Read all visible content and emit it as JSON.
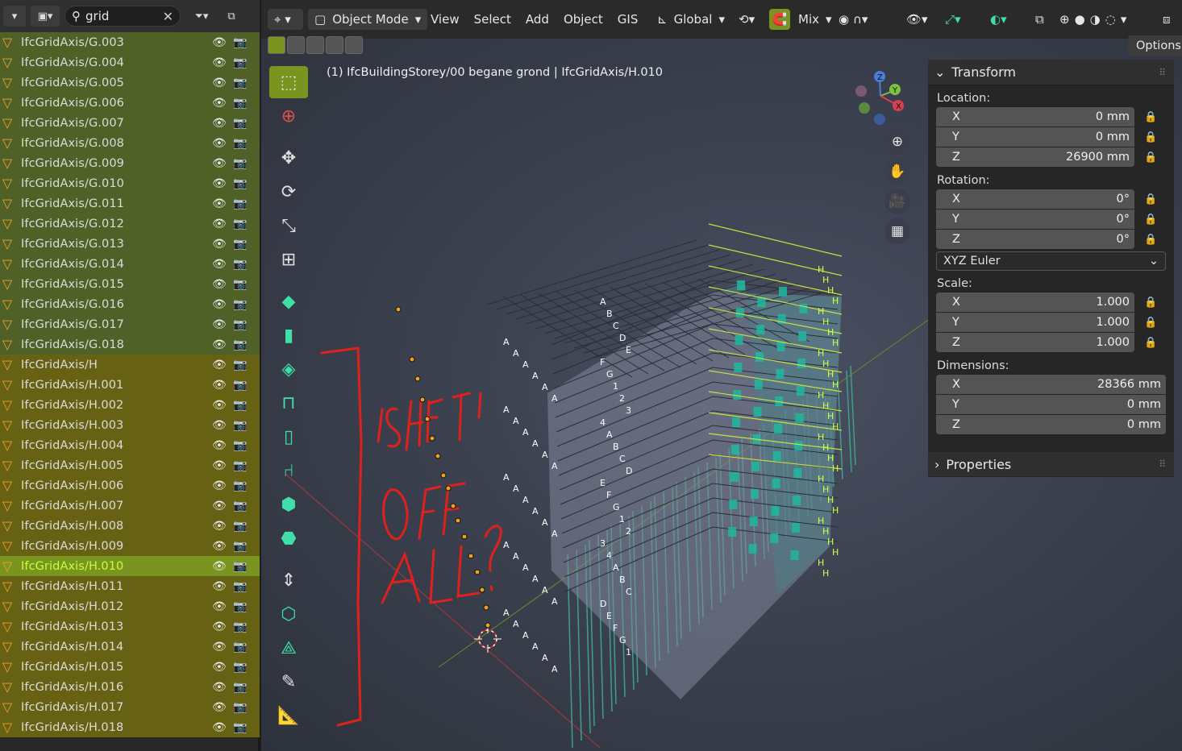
{
  "outliner": {
    "search_value": "grid",
    "items": [
      {
        "label": "IfcGridAxis/G.003",
        "group": "g"
      },
      {
        "label": "IfcGridAxis/G.004",
        "group": "g"
      },
      {
        "label": "IfcGridAxis/G.005",
        "group": "g"
      },
      {
        "label": "IfcGridAxis/G.006",
        "group": "g"
      },
      {
        "label": "IfcGridAxis/G.007",
        "group": "g"
      },
      {
        "label": "IfcGridAxis/G.008",
        "group": "g"
      },
      {
        "label": "IfcGridAxis/G.009",
        "group": "g"
      },
      {
        "label": "IfcGridAxis/G.010",
        "group": "g"
      },
      {
        "label": "IfcGridAxis/G.011",
        "group": "g"
      },
      {
        "label": "IfcGridAxis/G.012",
        "group": "g"
      },
      {
        "label": "IfcGridAxis/G.013",
        "group": "g"
      },
      {
        "label": "IfcGridAxis/G.014",
        "group": "g"
      },
      {
        "label": "IfcGridAxis/G.015",
        "group": "g"
      },
      {
        "label": "IfcGridAxis/G.016",
        "group": "g"
      },
      {
        "label": "IfcGridAxis/G.017",
        "group": "g"
      },
      {
        "label": "IfcGridAxis/G.018",
        "group": "g"
      },
      {
        "label": "IfcGridAxis/H",
        "group": "h"
      },
      {
        "label": "IfcGridAxis/H.001",
        "group": "h"
      },
      {
        "label": "IfcGridAxis/H.002",
        "group": "h"
      },
      {
        "label": "IfcGridAxis/H.003",
        "group": "h"
      },
      {
        "label": "IfcGridAxis/H.004",
        "group": "h"
      },
      {
        "label": "IfcGridAxis/H.005",
        "group": "h"
      },
      {
        "label": "IfcGridAxis/H.006",
        "group": "h"
      },
      {
        "label": "IfcGridAxis/H.007",
        "group": "h"
      },
      {
        "label": "IfcGridAxis/H.008",
        "group": "h"
      },
      {
        "label": "IfcGridAxis/H.009",
        "group": "h"
      },
      {
        "label": "IfcGridAxis/H.010",
        "group": "sel"
      },
      {
        "label": "IfcGridAxis/H.011",
        "group": "h"
      },
      {
        "label": "IfcGridAxis/H.012",
        "group": "h"
      },
      {
        "label": "IfcGridAxis/H.013",
        "group": "h"
      },
      {
        "label": "IfcGridAxis/H.014",
        "group": "h"
      },
      {
        "label": "IfcGridAxis/H.015",
        "group": "h"
      },
      {
        "label": "IfcGridAxis/H.016",
        "group": "h"
      },
      {
        "label": "IfcGridAxis/H.017",
        "group": "h"
      },
      {
        "label": "IfcGridAxis/H.018",
        "group": "h"
      }
    ]
  },
  "header": {
    "mode": "Object Mode",
    "menus": [
      "View",
      "Select",
      "Add",
      "Object",
      "GIS"
    ],
    "orientation": "Global",
    "snap_target": "Mix",
    "options": "Options"
  },
  "viewport": {
    "breadcrumb": "(1) IfcBuildingStorey/00 begane grond | IfcGridAxis/H.010",
    "annotation": "SHIFT OFF ALL?"
  },
  "transform": {
    "title": "Transform",
    "location_label": "Location:",
    "location": [
      {
        "axis": "X",
        "value": "0 mm"
      },
      {
        "axis": "Y",
        "value": "0 mm"
      },
      {
        "axis": "Z",
        "value": "26900 mm"
      }
    ],
    "rotation_label": "Rotation:",
    "rotation": [
      {
        "axis": "X",
        "value": "0°"
      },
      {
        "axis": "Y",
        "value": "0°"
      },
      {
        "axis": "Z",
        "value": "0°"
      }
    ],
    "rotation_mode": "XYZ Euler",
    "scale_label": "Scale:",
    "scale": [
      {
        "axis": "X",
        "value": "1.000"
      },
      {
        "axis": "Y",
        "value": "1.000"
      },
      {
        "axis": "Z",
        "value": "1.000"
      }
    ],
    "dimensions_label": "Dimensions:",
    "dimensions": [
      {
        "axis": "X",
        "value": "28366 mm"
      },
      {
        "axis": "Y",
        "value": "0 mm"
      },
      {
        "axis": "Z",
        "value": "0 mm"
      }
    ]
  },
  "properties": {
    "title": "Properties"
  },
  "colors": {
    "accent": "#7a9420",
    "selected_text": "#c6ff3a",
    "g_row": "#4f6127",
    "h_row": "#676114",
    "annotation": "#e0201a",
    "grid_teal": "#3fd0b0"
  }
}
